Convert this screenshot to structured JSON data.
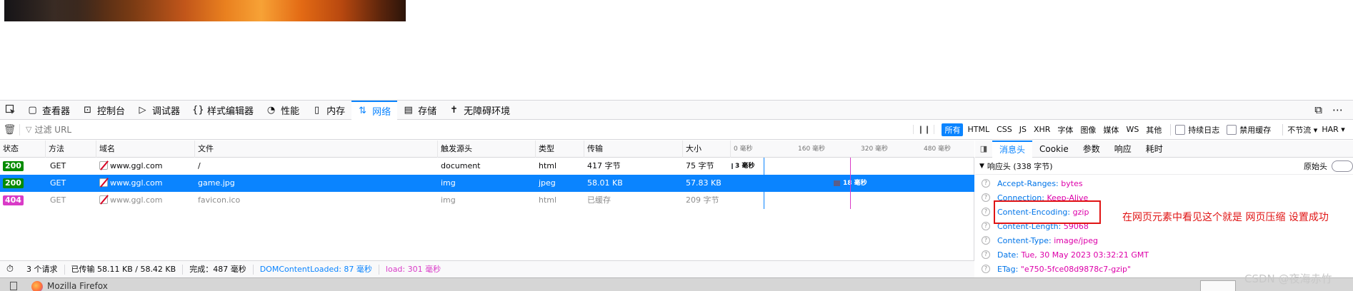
{
  "toolbar": {
    "tabs": [
      {
        "label": "查看器",
        "icon": "inspector-icon"
      },
      {
        "label": "控制台",
        "icon": "console-icon"
      },
      {
        "label": "调试器",
        "icon": "debugger-icon"
      },
      {
        "label": "样式编辑器",
        "icon": "style-editor-icon"
      },
      {
        "label": "性能",
        "icon": "performance-icon"
      },
      {
        "label": "内存",
        "icon": "memory-icon"
      },
      {
        "label": "网络",
        "icon": "network-icon",
        "active": true
      },
      {
        "label": "存储",
        "icon": "storage-icon"
      },
      {
        "label": "无障碍环境",
        "icon": "accessibility-icon"
      }
    ]
  },
  "filter": {
    "placeholder": "过滤 URL",
    "types": [
      "所有",
      "HTML",
      "CSS",
      "JS",
      "XHR",
      "字体",
      "图像",
      "媒体",
      "WS",
      "其他"
    ],
    "selected_type": "所有",
    "persist_log": "持续日志",
    "disable_cache": "禁用缓存",
    "throttle": "不节流 ▾",
    "har": "HAR ▾"
  },
  "columns": [
    "状态",
    "方法",
    "域名",
    "文件",
    "触发源头",
    "类型",
    "传输",
    "大小"
  ],
  "timeline_ticks": [
    "0 毫秒",
    "160 毫秒",
    "320 毫秒",
    "480 毫秒"
  ],
  "requests": [
    {
      "status": "200",
      "method": "GET",
      "domain": "www.ggl.com",
      "file": "/",
      "initiator": "document",
      "type": "html",
      "transferred": "417 字节",
      "size": "75 字节",
      "timing": "3 毫秒"
    },
    {
      "status": "200",
      "method": "GET",
      "domain": "www.ggl.com",
      "file": "game.jpg",
      "initiator": "img",
      "type": "jpeg",
      "transferred": "58.01 KB",
      "size": "57.83 KB",
      "timing": "18 毫秒",
      "selected": true
    },
    {
      "status": "404",
      "method": "GET",
      "domain": "www.ggl.com",
      "file": "favicon.ico",
      "initiator": "img",
      "type": "html",
      "transferred": "已缓存",
      "size": "209 字节",
      "timing": ""
    }
  ],
  "statusbar": {
    "requests": "3 个请求",
    "transferred": "已传输 58.11 KB / 58.42 KB",
    "finish": "完成：487 毫秒",
    "dom_loaded": "DOMContentLoaded: 87 毫秒",
    "load": "load: 301 毫秒"
  },
  "sidepanel": {
    "tabs": [
      "消息头",
      "Cookie",
      "参数",
      "响应",
      "耗时"
    ],
    "active_tab": "消息头",
    "section_title": "响应头 (338 字节)",
    "raw_label": "原始头",
    "headers": [
      {
        "name": "Accept-Ranges:",
        "value": "bytes"
      },
      {
        "name": "Connection:",
        "value": "Keep-Alive"
      },
      {
        "name": "Content-Encoding:",
        "value": "gzip"
      },
      {
        "name": "Content-Length:",
        "value": "59068"
      },
      {
        "name": "Content-Type:",
        "value": "image/jpeg"
      },
      {
        "name": "Date:",
        "value": "Tue, 30 May 2023 03:32:21 GMT"
      },
      {
        "name": "ETag:",
        "value": "\"e750-5fce08d9878c7-gzip\""
      }
    ]
  },
  "annotation": "在网页元素中看见这个就是  网页压缩  设置成功",
  "taskbar": {
    "app_label": "Mozilla Firefox"
  },
  "watermark": "CSDN @夜海赤竹",
  "colors": {
    "accent": "#0a84ff",
    "status_ok": "#058b00",
    "status_404": "#d93ac7",
    "annotation": "#e01414"
  }
}
